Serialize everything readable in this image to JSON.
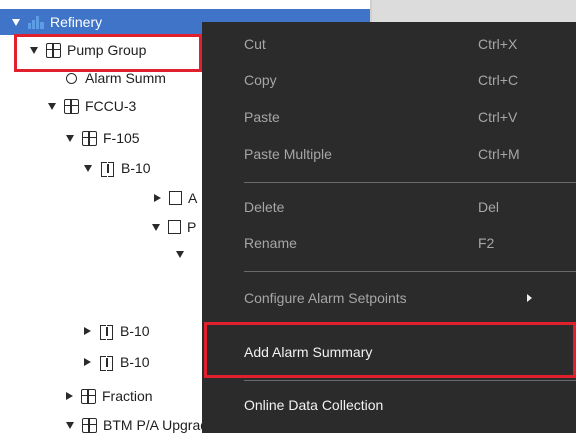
{
  "tree": {
    "items": [
      {
        "label": "Refinery"
      },
      {
        "label": "Pump Group"
      },
      {
        "label": "Alarm Summ"
      },
      {
        "label": "FCCU-3"
      },
      {
        "label": "F-105"
      },
      {
        "label": "B-10"
      },
      {
        "label": "A"
      },
      {
        "label": "P"
      },
      {
        "label": "B-10"
      },
      {
        "label": "B-10"
      },
      {
        "label": "Fraction"
      },
      {
        "label": "BTM P/A Upgrade"
      }
    ]
  },
  "menu": {
    "items": [
      {
        "label": "Cut",
        "shortcut": "Ctrl+X"
      },
      {
        "label": "Copy",
        "shortcut": "Ctrl+C"
      },
      {
        "label": "Paste",
        "shortcut": "Ctrl+V"
      },
      {
        "label": "Paste Multiple",
        "shortcut": "Ctrl+M"
      },
      {
        "label": "Delete",
        "shortcut": "Del"
      },
      {
        "label": "Rename",
        "shortcut": "F2"
      },
      {
        "label": "Configure Alarm Setpoints"
      },
      {
        "label": "Add Alarm Summary"
      },
      {
        "label": "Online Data Collection"
      }
    ]
  },
  "colors": {
    "selection": "#3f74c8",
    "highlight": "#e0202c",
    "menu_background": "#2b2b2b"
  }
}
